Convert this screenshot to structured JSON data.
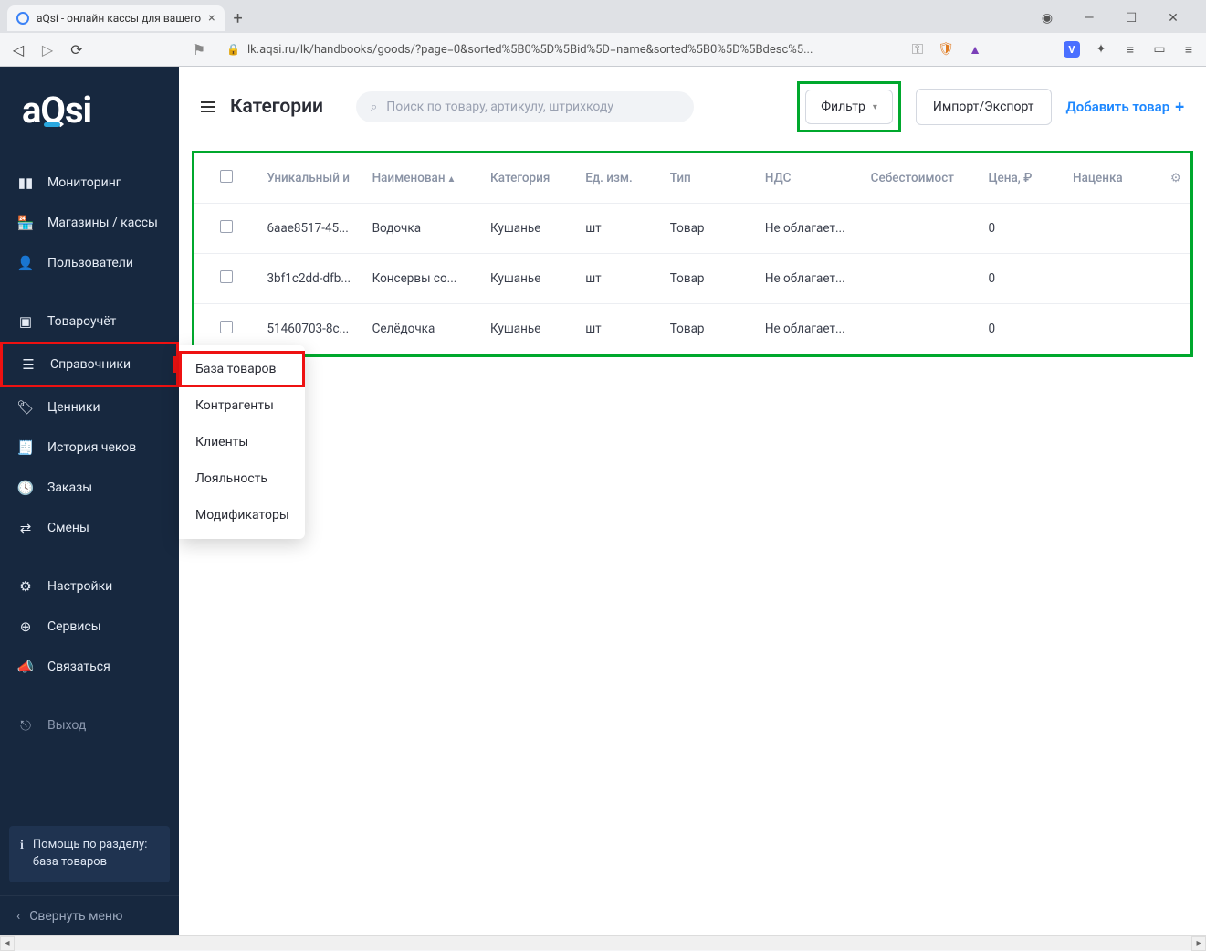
{
  "browser": {
    "tab_title": "aQsi - онлайн кассы для вашего",
    "url": "lk.aqsi.ru/lk/handbooks/goods/?page=0&sorted%5B0%5D%5Bid%5D=name&sorted%5B0%5D%5Bdesc%5..."
  },
  "logo": "aQsi",
  "sidebar": {
    "items": [
      {
        "icon": "bar-chart-icon",
        "label": "Мониторинг"
      },
      {
        "icon": "store-icon",
        "label": "Магазины / кассы"
      },
      {
        "icon": "user-icon",
        "label": "Пользователи"
      },
      {
        "icon": "box-icon",
        "label": "Товароучёт"
      },
      {
        "icon": "list-icon",
        "label": "Справочники"
      },
      {
        "icon": "tag-icon",
        "label": "Ценники"
      },
      {
        "icon": "receipt-icon",
        "label": "История чеков"
      },
      {
        "icon": "clock-icon",
        "label": "Заказы"
      },
      {
        "icon": "swap-icon",
        "label": "Смены"
      },
      {
        "icon": "gear-icon",
        "label": "Настройки"
      },
      {
        "icon": "plus-circle-icon",
        "label": "Сервисы"
      },
      {
        "icon": "megaphone-icon",
        "label": "Связаться"
      }
    ],
    "exit": "Выход",
    "help_title": "Помощь по разделу:",
    "help_sub": "база товаров",
    "collapse": "Свернуть меню"
  },
  "submenu": {
    "items": [
      "База товаров",
      "Контрагенты",
      "Клиенты",
      "Лояльность",
      "Модификаторы"
    ]
  },
  "header": {
    "title": "Категории",
    "search_placeholder": "Поиск по товару, артикулу, штрихкоду",
    "filter": "Фильтр",
    "import_export": "Импорт/Экспорт",
    "add_item": "Добавить товар"
  },
  "table": {
    "columns": [
      "Уникальный и",
      "Наименован",
      "Категория",
      "Ед. изм.",
      "Тип",
      "НДС",
      "Себестоимост",
      "Цена, ₽",
      "Наценка"
    ],
    "rows": [
      {
        "id": "6aae8517-45...",
        "name": "Водочка",
        "category": "Кушанье",
        "unit": "шт",
        "type": "Товар",
        "vat": "Не облагает...",
        "cost": "",
        "price": "0",
        "margin": ""
      },
      {
        "id": "3bf1c2dd-dfb...",
        "name": "Консервы со...",
        "category": "Кушанье",
        "unit": "шт",
        "type": "Товар",
        "vat": "Не облагает...",
        "cost": "",
        "price": "0",
        "margin": ""
      },
      {
        "id": "51460703-8c...",
        "name": "Селёдочка",
        "category": "Кушанье",
        "unit": "шт",
        "type": "Товар",
        "vat": "Не облагает...",
        "cost": "",
        "price": "0",
        "margin": ""
      }
    ]
  }
}
